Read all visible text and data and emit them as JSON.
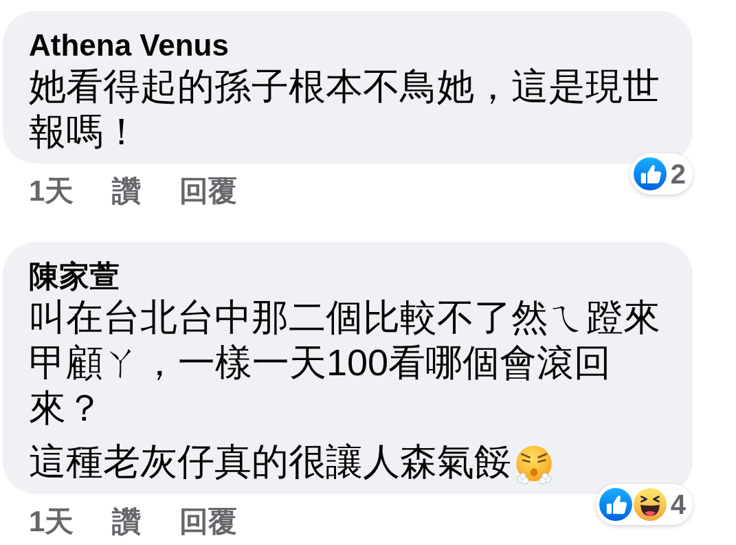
{
  "comments": [
    {
      "author": "Athena Venus",
      "paragraphs": [
        {
          "text": "她看得起的孫子根本不鳥她，這是現世報嗎！"
        }
      ],
      "reactions": [
        {
          "kind": "like"
        }
      ],
      "reaction_count": "2",
      "time": "1天",
      "actions": [
        "讚",
        "回覆"
      ]
    },
    {
      "author": "陳家萱",
      "paragraphs": [
        {
          "text": "叫在台北台中那二個比較不了然ㄟ蹬來甲顧ㄚ，一樣一天100看哪個會滾回來？"
        },
        {
          "text": "這種老灰仔真的很讓人森氣餒",
          "emoji": {
            "kind": "huff"
          }
        }
      ],
      "reactions": [
        {
          "kind": "like"
        },
        {
          "kind": "haha"
        }
      ],
      "reaction_count": "4",
      "time": "1天",
      "actions": [
        "讚",
        "回覆"
      ]
    }
  ]
}
